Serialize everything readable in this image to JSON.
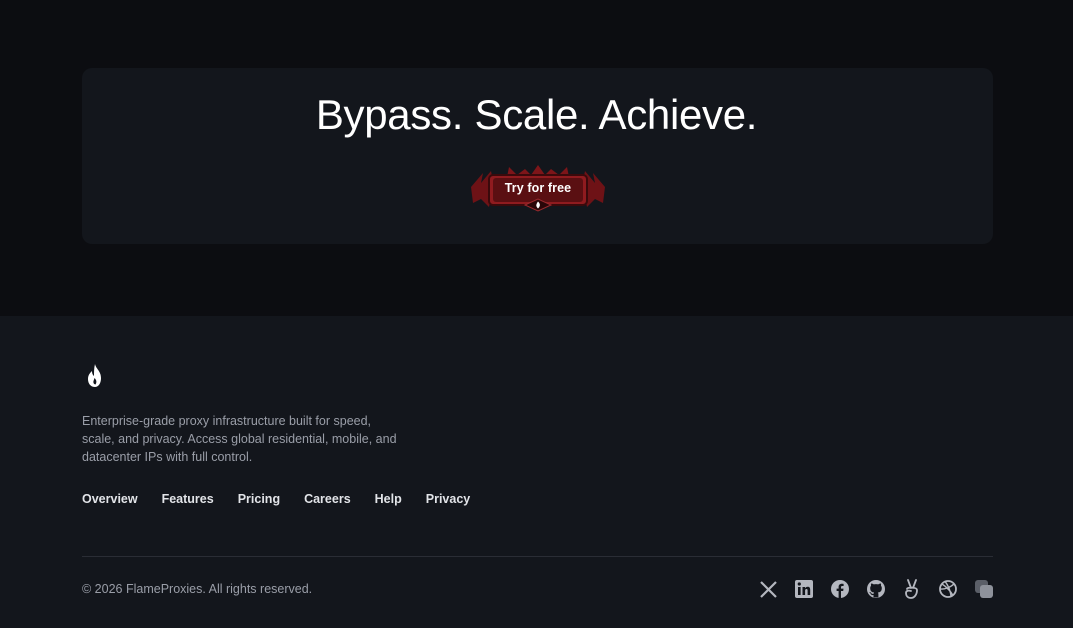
{
  "cta": {
    "title": "Bypass. Scale. Achieve.",
    "button_label": "Try for free"
  },
  "footer": {
    "logo_icon": "flame-icon",
    "description": "Enterprise-grade proxy infrastructure built for speed, scale, and privacy. Access global residential, mobile, and datacenter IPs with full control.",
    "nav": [
      "Overview",
      "Features",
      "Pricing",
      "Careers",
      "Help",
      "Privacy"
    ],
    "copyright": "© 2026 FlameProxies. All rights reserved.",
    "social": [
      "x-icon",
      "linkedin-icon",
      "facebook-icon",
      "github-icon",
      "angellist-icon",
      "dribbble-icon",
      "layers-icon"
    ]
  },
  "colors": {
    "page_bg": "#0c0d11",
    "card_bg": "#13161c",
    "button_red": "#8f1b1f",
    "text_muted": "#9a9ea8"
  }
}
